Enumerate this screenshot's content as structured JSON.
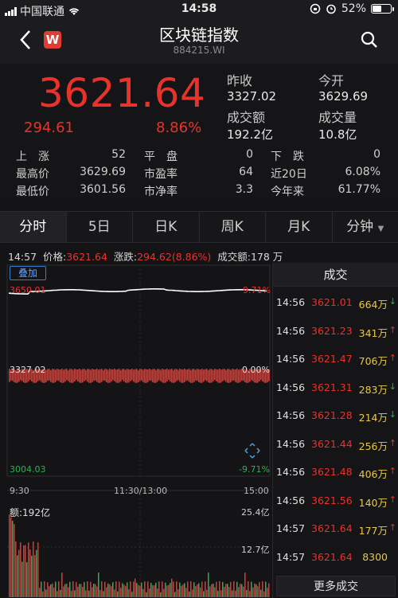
{
  "status_bar": {
    "carrier": "中国联通",
    "time": "14:58",
    "battery": "52%",
    "battery_level": 0.52
  },
  "nav": {
    "title": "区块链指数",
    "code": "884215.WI",
    "logo_letter": "W"
  },
  "quote": {
    "price": "3621.64",
    "change": "294.61",
    "change_pct": "8.86%",
    "prev_close_label": "昨收",
    "prev_close": "3327.02",
    "open_label": "今开",
    "open": "3629.69",
    "amount_label": "成交额",
    "amount": "192.2亿",
    "volume_label": "成交量",
    "volume": "10.8亿",
    "stats": [
      {
        "label": "上　涨",
        "value": "52"
      },
      {
        "label": "平　盘",
        "value": "0"
      },
      {
        "label": "下　跌",
        "value": "0"
      },
      {
        "label": "最高价",
        "value": "3629.69"
      },
      {
        "label": "市盈率",
        "value": "64"
      },
      {
        "label": "近20日",
        "value": "6.08%"
      },
      {
        "label": "最低价",
        "value": "3601.56"
      },
      {
        "label": "市净率",
        "value": "3.3"
      },
      {
        "label": "今年来",
        "value": "61.77%"
      }
    ]
  },
  "tabs": [
    "分时",
    "5日",
    "日K",
    "周K",
    "月K",
    "分钟"
  ],
  "info": {
    "time": "14:57",
    "price_label": "价格:",
    "price": "3621.64",
    "chg_label": "涨跌:",
    "chg": "294.62(8.86%)",
    "amount_label": "成交额:",
    "amount": "178 万"
  },
  "chart": {
    "overlay_label": "叠加",
    "y_top": "3650.01",
    "y_top_pct": "9.71%",
    "y_mid": "3327.02",
    "y_mid_pct": "0.00%",
    "y_bot": "3004.03",
    "y_bot_pct": "-9.71%",
    "times": [
      "9:30",
      "11:30/13:00",
      "15:00"
    ],
    "vol_label": "额:192亿",
    "vol_top": "25.4亿",
    "vol_mid": "12.7亿",
    "colors": {
      "up": "#e8332c",
      "down": "#2bb24c",
      "line": "#ffffff"
    }
  },
  "trades": {
    "title": "成交",
    "rows": [
      {
        "time": "14:56",
        "price": "3621.01",
        "vol": "664万",
        "dir": "down"
      },
      {
        "time": "14:56",
        "price": "3621.23",
        "vol": "341万",
        "dir": "up"
      },
      {
        "time": "14:56",
        "price": "3621.47",
        "vol": "706万",
        "dir": "up"
      },
      {
        "time": "14:56",
        "price": "3621.31",
        "vol": "283万",
        "dir": "down"
      },
      {
        "time": "14:56",
        "price": "3621.28",
        "vol": "214万",
        "dir": "down"
      },
      {
        "time": "14:56",
        "price": "3621.44",
        "vol": "256万",
        "dir": "up"
      },
      {
        "time": "14:56",
        "price": "3621.48",
        "vol": "406万",
        "dir": "up"
      },
      {
        "time": "14:56",
        "price": "3621.56",
        "vol": "140万",
        "dir": "up"
      },
      {
        "time": "14:57",
        "price": "3621.64",
        "vol": "177万",
        "dir": "up"
      },
      {
        "time": "14:57",
        "price": "3621.64",
        "vol": "8300",
        "dir": "none"
      }
    ],
    "more_label": "更多成交"
  }
}
